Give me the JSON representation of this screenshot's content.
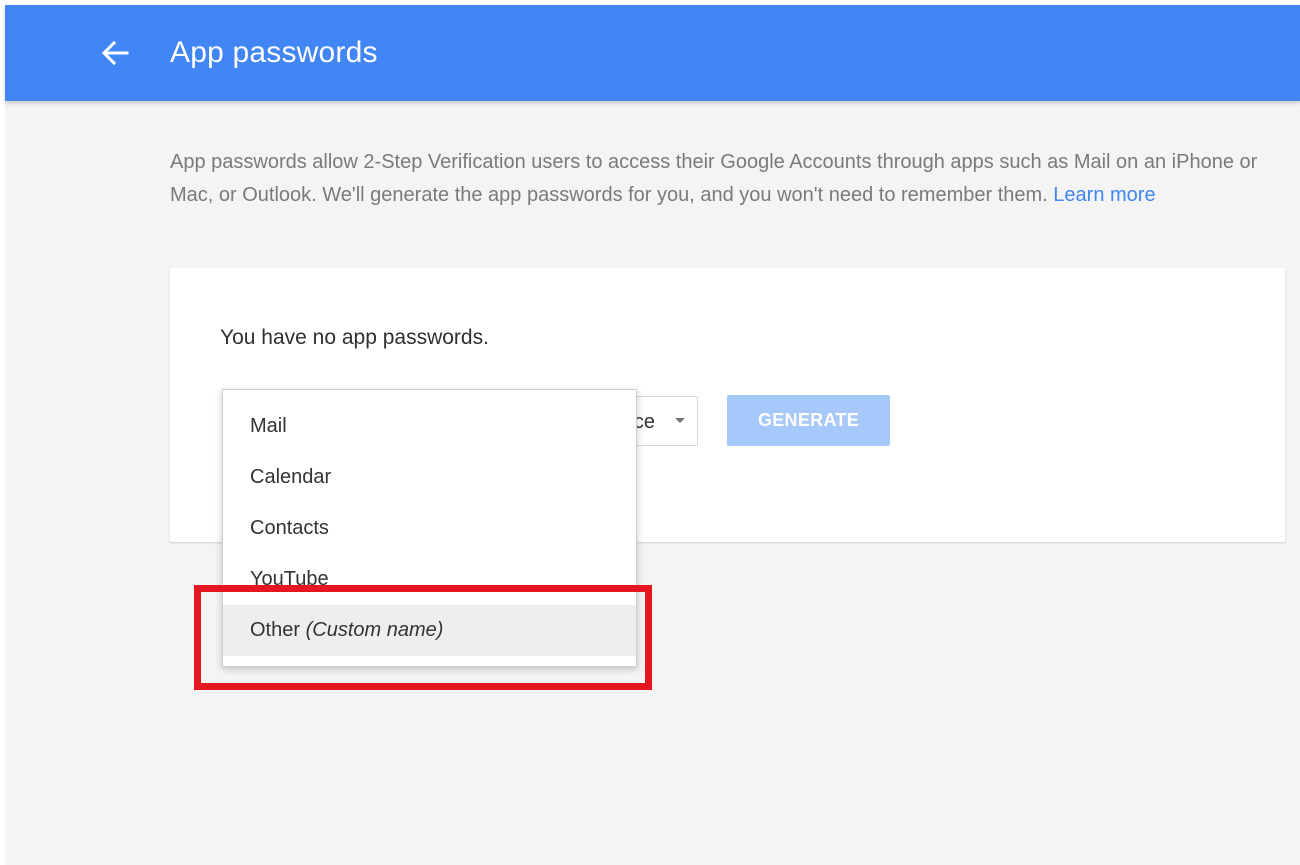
{
  "header": {
    "title": "App passwords",
    "back_icon": "arrow-left-icon",
    "bar_color": "#4285f4"
  },
  "intro": {
    "text": "App passwords allow 2-Step Verification users to access their Google Accounts through apps such as Mail on an iPhone or Mac, or Outlook. We'll generate the app passwords for you, and you won't need to remember them.",
    "learn_more_label": "Learn more",
    "link_color": "#4285f4"
  },
  "card": {
    "empty_message": "You have no app passwords.",
    "device_select": {
      "visible_value": "ce",
      "arrow_icon": "caret-down-icon"
    },
    "generate_label": "GENERATE",
    "generate_color": "#a6c8fa"
  },
  "app_dropdown": {
    "items": [
      {
        "label": "Mail"
      },
      {
        "label": "Calendar"
      },
      {
        "label": "Contacts"
      },
      {
        "label": "YouTube"
      },
      {
        "label": "Other",
        "sub_label": "(Custom name)"
      }
    ],
    "highlighted": "Other"
  },
  "annotation": {
    "color": "#e4161f"
  }
}
